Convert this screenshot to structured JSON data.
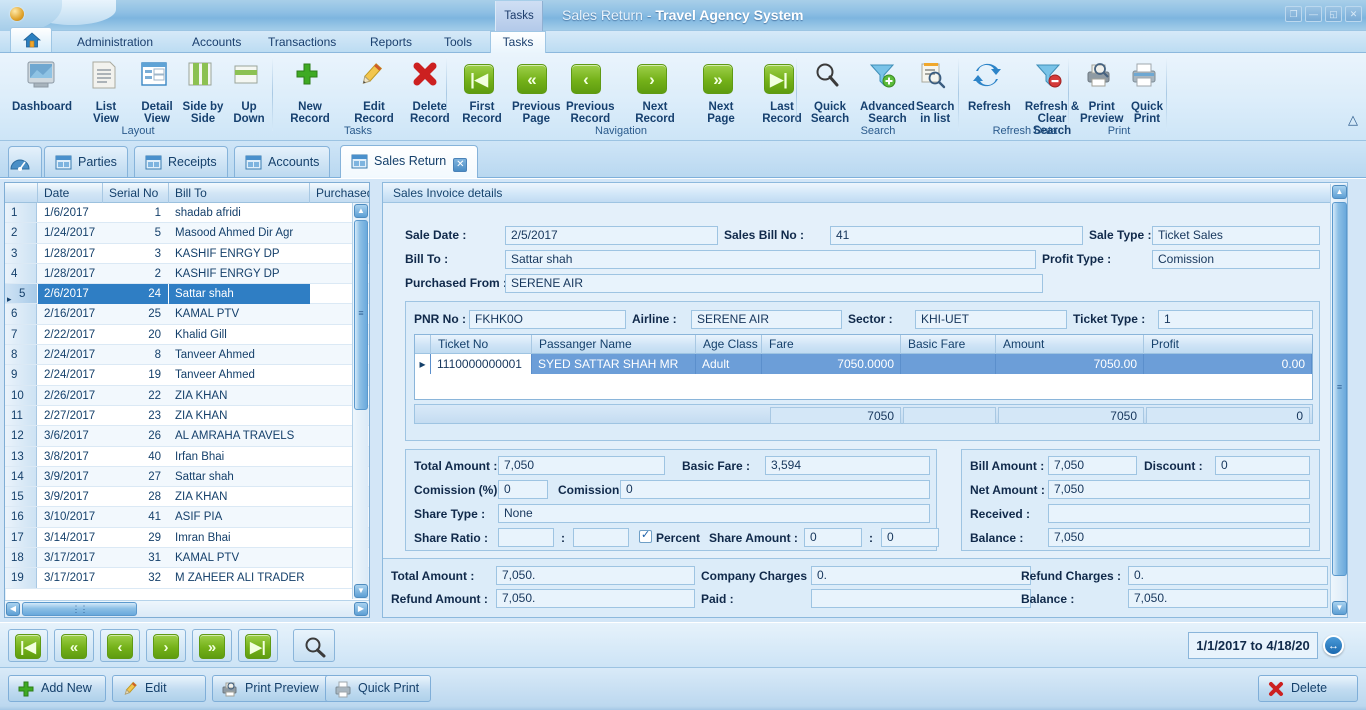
{
  "window": {
    "context_tab": "Tasks",
    "title_light": "Sales Return - ",
    "title_bold": "Travel Agency System",
    "controls": [
      {
        "name": "restore-down-icon",
        "glyph": "❐"
      },
      {
        "name": "minimize-icon",
        "glyph": "—"
      },
      {
        "name": "maximize-icon",
        "glyph": "◱"
      },
      {
        "name": "close-icon",
        "glyph": "✕"
      }
    ]
  },
  "menu": {
    "home_icon": "home-icon",
    "items": [
      {
        "label": "Administration",
        "active": false
      },
      {
        "label": "Accounts",
        "active": false
      },
      {
        "label": "Transactions",
        "active": false
      },
      {
        "label": "Reports",
        "active": false
      },
      {
        "label": "Tools",
        "active": false
      },
      {
        "label": "Tasks",
        "active": true
      }
    ]
  },
  "ribbon": {
    "groups": [
      {
        "title": "Layout",
        "items": [
          {
            "label": "Dashboard",
            "icon": "dashboard-icon"
          },
          {
            "label": "List View",
            "icon": "list-view-icon"
          },
          {
            "label": "Detail View",
            "icon": "detail-view-icon"
          },
          {
            "label": "Side by Side",
            "icon": "side-by-side-icon"
          },
          {
            "label": "Up Down",
            "icon": "up-down-icon"
          }
        ]
      },
      {
        "title": "Tasks",
        "items": [
          {
            "label": "New Record",
            "icon": "plus-icon"
          },
          {
            "label": "Edit Record",
            "icon": "pencil-icon"
          },
          {
            "label": "Delete Record",
            "icon": "red-x-icon"
          }
        ]
      },
      {
        "title": "Navigation",
        "items": [
          {
            "label": "First Record",
            "icon": "first-record-icon",
            "glyph": "|◀"
          },
          {
            "label": "Previous Page",
            "icon": "previous-page-icon",
            "glyph": "«"
          },
          {
            "label": "Previous Record",
            "icon": "previous-record-icon",
            "glyph": "‹"
          },
          {
            "label": "Next Record",
            "icon": "next-record-icon",
            "glyph": "›"
          },
          {
            "label": "Next Page",
            "icon": "next-page-icon",
            "glyph": "»"
          },
          {
            "label": "Last Record",
            "icon": "last-record-icon",
            "glyph": "▶|"
          }
        ]
      },
      {
        "title": "Search",
        "items": [
          {
            "label": "Quick Search",
            "icon": "magnifier-icon"
          },
          {
            "label": "Advanced Search",
            "icon": "funnel-plus-icon"
          },
          {
            "label": "Search in list",
            "icon": "search-in-list-icon"
          }
        ]
      },
      {
        "title": "Refresh Data",
        "items": [
          {
            "label": "Refresh",
            "icon": "refresh-arrows-icon"
          },
          {
            "label": "Refresh & Clear Search",
            "icon": "funnel-clear-icon"
          }
        ]
      },
      {
        "title": "Print",
        "items": [
          {
            "label": "Print Preview",
            "icon": "print-preview-icon"
          },
          {
            "label": "Quick Print",
            "icon": "printer-icon"
          }
        ]
      }
    ],
    "collapse_icon": "chevron-up-icon"
  },
  "doc_tabs": [
    {
      "label": "",
      "icon": "dashboard-gauge-icon",
      "selected": false,
      "closable": false
    },
    {
      "label": "Parties",
      "icon": "window-icon",
      "selected": false,
      "closable": false
    },
    {
      "label": "Receipts",
      "icon": "window-icon",
      "selected": false,
      "closable": false
    },
    {
      "label": "Accounts",
      "icon": "window-icon",
      "selected": false,
      "closable": false
    },
    {
      "label": "Sales Return",
      "icon": "window-icon",
      "selected": true,
      "closable": true
    }
  ],
  "list_grid": {
    "columns": [
      "Date",
      "Serial No",
      "Bill To",
      "Purchased"
    ],
    "rows": [
      {
        "idx": "1",
        "date": "1/6/2017",
        "serial": "1",
        "bill_to": "shadab afridi",
        "purchased": "",
        "selected": false
      },
      {
        "idx": "2",
        "date": "1/24/2017",
        "serial": "5",
        "bill_to": "Masood Ahmed Dir Agr",
        "purchased": "",
        "selected": false
      },
      {
        "idx": "3",
        "date": "1/28/2017",
        "serial": "3",
        "bill_to": "KASHIF ENRGY DP",
        "purchased": "",
        "selected": false
      },
      {
        "idx": "4",
        "date": "1/28/2017",
        "serial": "2",
        "bill_to": "KASHIF ENRGY DP",
        "purchased": "",
        "selected": false
      },
      {
        "idx": "5",
        "date": "2/6/2017",
        "serial": "24",
        "bill_to": "Sattar shah",
        "purchased": "",
        "selected": true
      },
      {
        "idx": "6",
        "date": "2/16/2017",
        "serial": "25",
        "bill_to": "KAMAL PTV",
        "purchased": "",
        "selected": false
      },
      {
        "idx": "7",
        "date": "2/22/2017",
        "serial": "20",
        "bill_to": "Khalid Gill",
        "purchased": "",
        "selected": false
      },
      {
        "idx": "8",
        "date": "2/24/2017",
        "serial": "8",
        "bill_to": "Tanveer Ahmed",
        "purchased": "",
        "selected": false
      },
      {
        "idx": "9",
        "date": "2/24/2017",
        "serial": "19",
        "bill_to": "Tanveer Ahmed",
        "purchased": "",
        "selected": false
      },
      {
        "idx": "10",
        "date": "2/26/2017",
        "serial": "22",
        "bill_to": "ZIA KHAN",
        "purchased": "",
        "selected": false
      },
      {
        "idx": "11",
        "date": "2/27/2017",
        "serial": "23",
        "bill_to": "ZIA KHAN",
        "purchased": "",
        "selected": false
      },
      {
        "idx": "12",
        "date": "3/6/2017",
        "serial": "26",
        "bill_to": "AL AMRAHA TRAVELS",
        "purchased": "",
        "selected": false
      },
      {
        "idx": "13",
        "date": "3/8/2017",
        "serial": "40",
        "bill_to": "Irfan Bhai",
        "purchased": "",
        "selected": false
      },
      {
        "idx": "14",
        "date": "3/9/2017",
        "serial": "27",
        "bill_to": "Sattar shah",
        "purchased": "",
        "selected": false
      },
      {
        "idx": "15",
        "date": "3/9/2017",
        "serial": "28",
        "bill_to": "ZIA KHAN",
        "purchased": "",
        "selected": false
      },
      {
        "idx": "16",
        "date": "3/10/2017",
        "serial": "41",
        "bill_to": "ASIF PIA",
        "purchased": "",
        "selected": false
      },
      {
        "idx": "17",
        "date": "3/14/2017",
        "serial": "29",
        "bill_to": "Imran Bhai",
        "purchased": "",
        "selected": false
      },
      {
        "idx": "18",
        "date": "3/17/2017",
        "serial": "31",
        "bill_to": "KAMAL PTV",
        "purchased": "",
        "selected": false
      },
      {
        "idx": "19",
        "date": "3/17/2017",
        "serial": "32",
        "bill_to": "M ZAHEER ALI TRADER",
        "purchased": "",
        "selected": false
      }
    ]
  },
  "detail": {
    "panel_title": "Sales Invoice details",
    "sale_date_label": "Sale Date :",
    "sale_date_value": "2/5/2017",
    "sales_bill_no_label": "Sales Bill No :",
    "sales_bill_no_value": "41",
    "sale_type_label": "Sale Type :",
    "sale_type_value": "Ticket Sales",
    "bill_to_label": "Bill To :",
    "bill_to_value": "Sattar shah",
    "profit_type_label": "Profit Type :",
    "profit_type_value": "Comission",
    "purchased_from_label": "Purchased From :",
    "purchased_from_value": "SERENE AIR",
    "pnr_label": "PNR No :",
    "pnr_value": "FKHK0O",
    "airline_label": "Airline :",
    "airline_value": "SERENE AIR",
    "sector_label": "Sector :",
    "sector_value": "KHI-UET",
    "ticket_type_label": "Ticket Type :",
    "ticket_type_value": "1",
    "ticket_grid": {
      "columns": [
        "Ticket No",
        "Passanger Name",
        "Age Class",
        "Fare",
        "Basic Fare",
        "Amount",
        "Profit"
      ],
      "rows": [
        {
          "ticket_no": "1110000000001",
          "passenger": "SYED SATTAR SHAH MR",
          "age_class": "Adult",
          "fare": "7050.0000",
          "basic_fare": "",
          "amount": "7050.00",
          "profit": "0.00",
          "selected": true
        }
      ],
      "totals": {
        "fare": "7050",
        "basic_fare": "",
        "amount": "7050",
        "profit": "0"
      }
    },
    "total_amount_label": "Total Amount :",
    "total_amount_value": "7,050",
    "basic_fare_label": "Basic Fare :",
    "basic_fare_value": "3,594",
    "comission_pct_label": "Comission (%) :",
    "comission_pct_value": "0",
    "comission_label": "Comission :",
    "comission_value": "0",
    "share_type_label": "Share Type :",
    "share_type_value": "None",
    "share_ratio_label": "Share Ratio :",
    "share_ratio_a": "",
    "share_ratio_b": "",
    "percent_label": "Percent",
    "percent_checked": true,
    "share_amount_label": "Share Amount :",
    "share_amount_a": "0",
    "share_amount_b": "0",
    "colon": ":",
    "bill_amount_label": "Bill Amount :",
    "bill_amount_value": "7,050",
    "discount_label": "Discount :",
    "discount_value": "0",
    "net_amount_label": "Net Amount :",
    "net_amount_value": "7,050",
    "received_label": "Received :",
    "received_value": "",
    "balance_label": "Balance :",
    "balance_value": "7,050",
    "footer_total_amount_label": "Total Amount :",
    "footer_total_amount_value": "7,050.",
    "footer_company_charges_label": "Company Charges :",
    "footer_company_charges_value": "0.",
    "footer_refund_charges_label": "Refund Charges :",
    "footer_refund_charges_value": "0.",
    "footer_refund_amount_label": "Refund Amount :",
    "footer_refund_amount_value": "7,050.",
    "footer_paid_label": "Paid :",
    "footer_paid_value": "",
    "footer_balance_label": "Balance :",
    "footer_balance_value": "7,050."
  },
  "bottom": {
    "nav_buttons": [
      {
        "name": "bottom-first-record-button",
        "glyph": "|◀"
      },
      {
        "name": "bottom-previous-page-button",
        "glyph": "«"
      },
      {
        "name": "bottom-previous-record-button",
        "glyph": "‹"
      },
      {
        "name": "bottom-next-record-button",
        "glyph": "›"
      },
      {
        "name": "bottom-next-page-button",
        "glyph": "»"
      },
      {
        "name": "bottom-last-record-button",
        "glyph": "▶|"
      }
    ],
    "search_icon": "magnifier-icon",
    "date_range": "1/1/2017 to 4/18/20",
    "date_range_toggle_icon": "expand-horizontal-icon",
    "actions": [
      {
        "label": "Add New",
        "icon": "green-plus-icon"
      },
      {
        "label": "Edit",
        "icon": "pencil-icon"
      },
      {
        "label": "Print Preview",
        "icon": "print-preview-icon"
      },
      {
        "label": "Quick Print",
        "icon": "printer-icon"
      }
    ],
    "delete": {
      "label": "Delete",
      "icon": "red-x-icon"
    }
  }
}
